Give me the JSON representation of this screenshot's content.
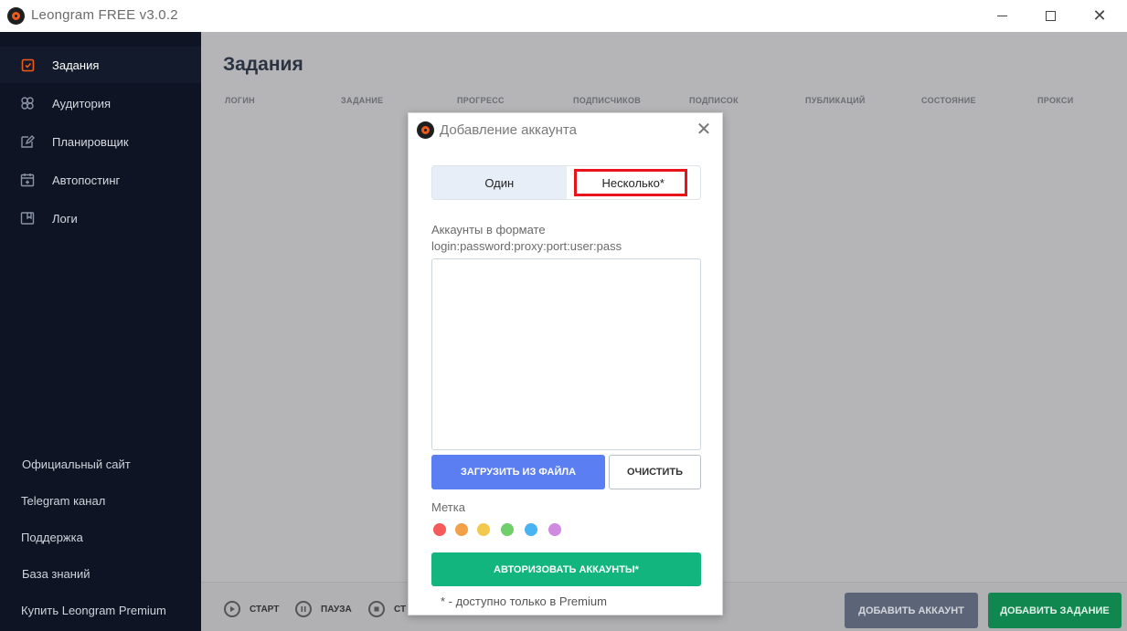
{
  "window": {
    "title": "Leongram FREE v3.0.2"
  },
  "sidebar": {
    "items": [
      {
        "label": "Задания",
        "icon": "tasks-icon",
        "active": true
      },
      {
        "label": "Аудитория",
        "icon": "audience-icon",
        "active": false
      },
      {
        "label": "Планировщик",
        "icon": "planner-icon",
        "active": false
      },
      {
        "label": "Автопостинг",
        "icon": "calendar-icon",
        "active": false
      },
      {
        "label": "Логи",
        "icon": "logs-icon",
        "active": false
      }
    ],
    "links": [
      "Официальный сайт",
      "Telegram канал",
      "Поддержка",
      "База знаний",
      "Купить Leongram Premium"
    ]
  },
  "main": {
    "title": "Задания",
    "columns": [
      "ЛОГИН",
      "ЗАДАНИЕ",
      "ПРОГРЕСС",
      "ПОДПИСЧИКОВ",
      "ПОДПИСОК",
      "ПУБЛИКАЦИЙ",
      "СОСТОЯНИЕ",
      "ПРОКСИ"
    ],
    "controls": {
      "start": "СТАРТ",
      "pause": "ПАУЗА",
      "stop_partial": "СТ"
    },
    "add_account": "ДОБАВИТЬ АККАУНТ",
    "add_task": "ДОБАВИТЬ ЗАДАНИЕ"
  },
  "dialog": {
    "title": "Добавление  аккаунта",
    "tabs": [
      "Один",
      "Несколько*"
    ],
    "active_tab": "Несколько*",
    "accounts_label_line1": "Аккаунты в формате",
    "accounts_label_line2": "login:password:proxy:port:user:pass",
    "accounts_value": "",
    "load_from_file": "ЗАГРУЗИТЬ ИЗ ФАЙЛА",
    "clear": "ОЧИСТИТЬ",
    "tag_label": "Метка",
    "tag_colors": [
      "#f55b5b",
      "#f2a04a",
      "#f2c94c",
      "#6fcf6a",
      "#4ab3f2",
      "#d08ae0"
    ],
    "authorize": "АВТОРИЗОВАТЬ АККАУНТЫ*",
    "premium_note": "* - доступно только в Premium"
  },
  "colors": {
    "sidebar_bg": "#0e1423",
    "accent_orange": "#f05a1a",
    "primary_blue": "#5b7ff2",
    "primary_green": "#12b57e",
    "highlight_red": "#e8141c"
  }
}
